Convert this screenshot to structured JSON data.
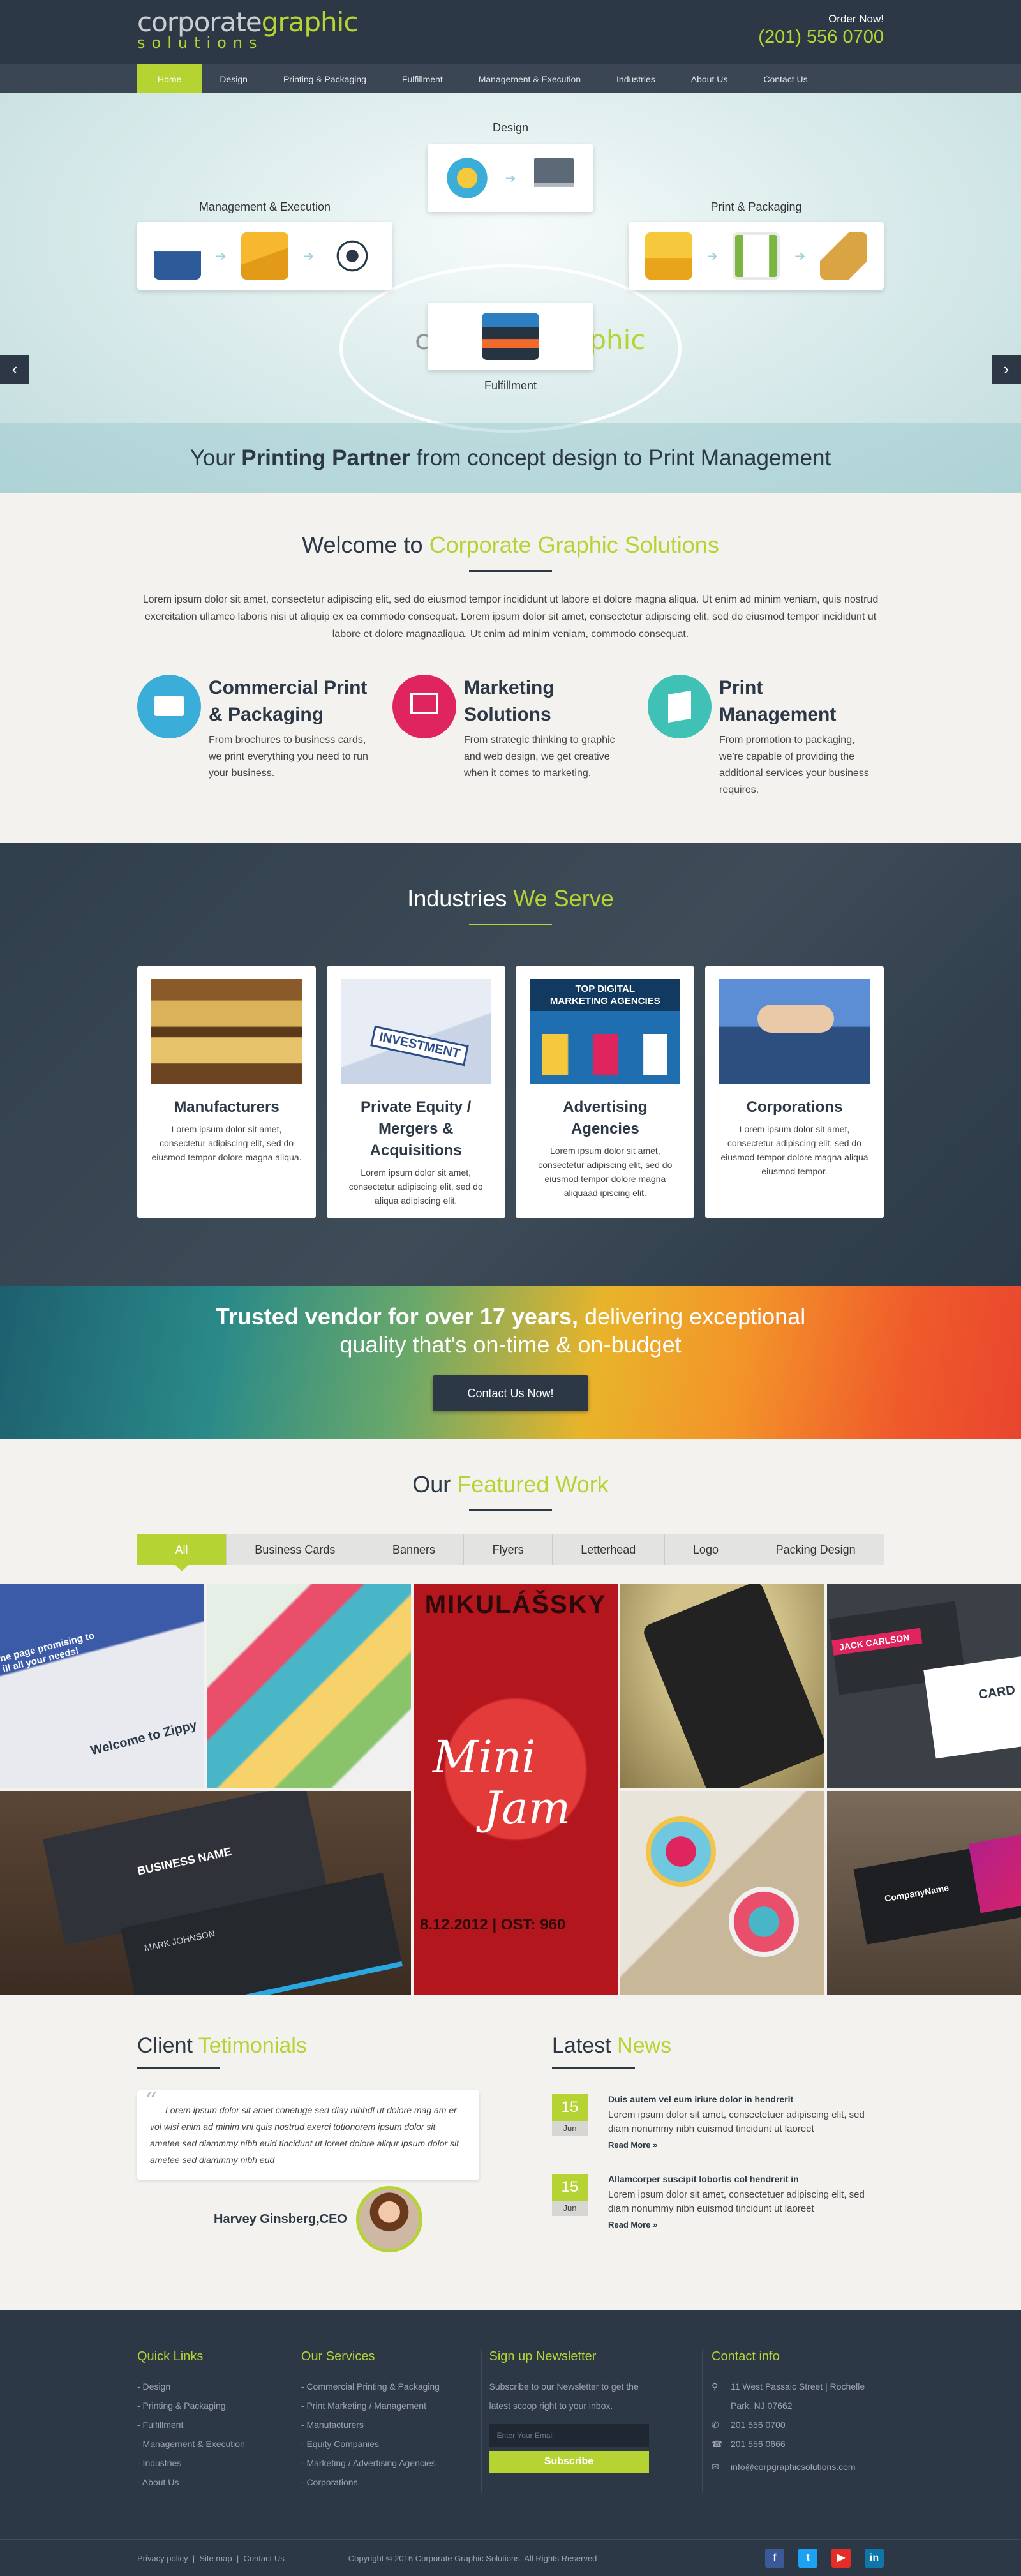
{
  "header": {
    "logo_part1": "corporate",
    "logo_part2": "graphic",
    "logo_part3": "solutions",
    "order_label": "Order Now!",
    "phone": "(201) 556 0700"
  },
  "nav": [
    "Home",
    "Design",
    "Printing & Packaging",
    "Fulfillment",
    "Management & Execution",
    "Industries",
    "About Us",
    "Contact Us"
  ],
  "hero": {
    "labels": {
      "design": "Design",
      "print": "Printing & Packaging",
      "print_display": "Print & Packaging",
      "management": "Management & Execution",
      "fulfillment": "Fulfillment"
    },
    "tagline_pre": "Your ",
    "tagline_bold": "Printing Partner",
    "tagline_post": " from concept design to Print Management"
  },
  "welcome": {
    "title": "Welcome to ",
    "title_green": "Corporate Graphic Solutions",
    "text": "Lorem ipsum dolor sit amet, consectetur adipiscing elit, sed do eiusmod tempor incididunt ut labore et dolore magna aliqua. Ut enim ad minim veniam, quis nostrud exercitation ullamco laboris nisi ut aliquip ex ea commodo consequat. Lorem ipsum dolor sit amet, consectetur adipiscing elit, sed do eiusmod tempor incididunt ut labore et dolore magnaaliqua. Ut enim ad minim veniam,  commodo consequat.",
    "services": [
      {
        "title": "Commercial Print & Packaging",
        "text": "From brochures to business cards, we print everything you need to run your business.",
        "color": "#3aaed8"
      },
      {
        "title": "Marketing Solutions",
        "text": "From strategic thinking to graphic and web design, we get creative when it comes to marketing.",
        "color": "#e0245e"
      },
      {
        "title": "Print Management",
        "text": "From promotion to packaging, we're capable of providing the additional services your business requires.",
        "color": "#3fc1b5"
      }
    ]
  },
  "industries": {
    "title": "Industries ",
    "title_green": "We Serve",
    "cards": [
      {
        "title": "Manufacturers",
        "text": "Lorem ipsum dolor sit amet, consectetur adipiscing elit, sed do eiusmod tempor  dolore magna aliqua."
      },
      {
        "title": "Private Equity / Mergers & Acquisitions",
        "text": "Lorem ipsum dolor sit amet, consectetur adipiscing elit, sed do aliqua adipiscing elit."
      },
      {
        "title": "Advertising Agencies",
        "text": "Lorem ipsum dolor sit amet, consectetur adipiscing elit, sed do eiusmod tempor  dolore magna aliquaad ipiscing elit."
      },
      {
        "title": "Corporations",
        "text": "Lorem ipsum dolor sit amet, consectetur adipiscing elit, sed do eiusmod tempor  dolore magna aliqua eiusmod tempor."
      }
    ],
    "image_texts": {
      "investment": "INVESTMENT",
      "agency": "TOP DIGITAL MARKETING AGENCIES"
    }
  },
  "trusted": {
    "line1_bold": "Trusted vendor for over 17 years,",
    "line1_rest": " delivering exceptional",
    "line2": "quality that's on-time & on-budget",
    "button": "Contact Us Now!"
  },
  "featured": {
    "title": "Our ",
    "title_green": "Featured Work",
    "tabs": [
      "All",
      "Business Cards",
      "Banners",
      "Flyers",
      "Letterhead",
      "Logo",
      "Packing Design"
    ],
    "image_texts": {
      "zippy1": "ne page promising to",
      "zippy2": "ill all your needs!",
      "zippy3": "Welcome to Zippy",
      "jack": "JACK CARLSON",
      "card": "CARD",
      "business": "BUSINESS",
      "name": "NAME",
      "mark": "MARK JOHNSON",
      "mikulassky": "MIKULÁŠSKY",
      "mini": "Mini",
      "jam": "Jam",
      "date": "8.12.2012 | OST: 960",
      "company": "CompanyName"
    }
  },
  "testimonials": {
    "title": "Client ",
    "title_green": "Tetimonials",
    "quote": "Lorem ipsum dolor sit amet conetuge sed diay nibhdl  ut  dolore mag am er vol wisi enim ad minim vni quis nostrud exerci totionorem ipsum dolor sit ametee sed diammmy nibh euid tincidunt ut loreet dolore  aliqur ipsum dolor sit ametee sed diammmy nibh eud",
    "author": "Harvey Ginsberg,CEO"
  },
  "news": {
    "title": "Latest ",
    "title_green": "News",
    "items": [
      {
        "day": "15",
        "month": "Jun",
        "title": "Duis autem vel eum iriure dolor in hendrerit",
        "text": "Lorem ipsum dolor sit amet, consectetuer adipiscing elit, sed diam nonummy nibh euismod tincidunt ut laoreet",
        "more": "Read More »"
      },
      {
        "day": "15",
        "month": "Jun",
        "title": "Allamcorper suscipit lobortis  col hendrerit in",
        "text": "Lorem ipsum dolor sit amet, consectetuer adipiscing elit, sed diam nonummy nibh euismod tincidunt ut laoreet",
        "more": "Read More »"
      }
    ]
  },
  "footer": {
    "quick_title": "Quick Links",
    "quick": [
      "- Design",
      "- Printing & Packaging",
      "- Fulfillment",
      "- Management & Execution",
      "- Industries",
      "- About Us"
    ],
    "services_title": "Our Services",
    "services": [
      "- Commercial Printing & Packaging",
      "- Print Marketing / Management",
      "- Manufacturers",
      "- Equity Companies",
      "- Marketing / Advertising Agencies",
      "- Corporations"
    ],
    "newsletter_title": "Sign up Newsletter",
    "newsletter_text": "Subscribe to our Newsletter to get the latest scoop right to your inbox.",
    "email_placeholder": "Enter Your Email",
    "subscribe": "Subscribe",
    "contact_title": "Contact info",
    "address": "11 West Passaic Street | Rochelle Park, NJ 07662",
    "phone": "201 556 0700",
    "fax": "201 556 0666",
    "email": "info@corpgraphicsolutions.com",
    "links": [
      "Privacy policy",
      "Site map",
      "Contact Us"
    ],
    "copyright": "Copyright © 2016 Corporate Graphic Solutions, All Rights Reserved",
    "social_colors": {
      "facebook": "#3b5998",
      "twitter": "#1da1f2",
      "youtube": "#e52d27",
      "linkedin": "#0e76a8"
    }
  },
  "colors": {
    "accent": "#b6d334",
    "dark": "#2c3846"
  }
}
